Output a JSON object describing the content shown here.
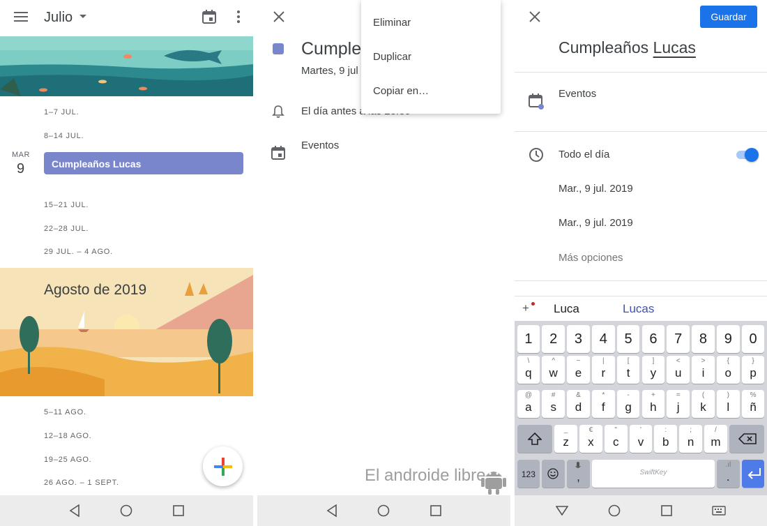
{
  "panel1": {
    "month": "Julio",
    "weeks_july": [
      "1–7 JUL.",
      "8–14 JUL.",
      "15–21 JUL.",
      "22–28 JUL.",
      "29 JUL. – 4 AGO."
    ],
    "day": {
      "dow": "MAR",
      "num": "9"
    },
    "event_label": "Cumpleaños Lucas",
    "august_title": "Agosto de 2019",
    "weeks_august": [
      "5–11 AGO.",
      "12–18 AGO.",
      "19–25 AGO.",
      "26 AGO. – 1 SEPT."
    ]
  },
  "panel2": {
    "event_title": "Cumpleaños Lucas",
    "event_date": "Martes, 9 jul",
    "reminder": "El día antes a las 23:30",
    "calendar": "Eventos",
    "menu": [
      "Eliminar",
      "Duplicar",
      "Copiar en…"
    ],
    "watermark": "El androide libre"
  },
  "panel3": {
    "save_label": "Guardar",
    "title_prefix": "Cumpleaños",
    "title_word": "Lucas",
    "calendar": "Eventos",
    "all_day_label": "Todo el día",
    "all_day_on": true,
    "start_date": "Mar., 9 jul. 2019",
    "end_date": "Mar., 9 jul. 2019",
    "more_options": "Más opciones",
    "suggestions": [
      "Luca",
      "Lucas"
    ],
    "keyboard": {
      "numbers": [
        "1",
        "2",
        "3",
        "4",
        "5",
        "6",
        "7",
        "8",
        "9",
        "0"
      ],
      "row1": [
        "q",
        "w",
        "e",
        "r",
        "t",
        "y",
        "u",
        "i",
        "o",
        "p"
      ],
      "row1_alt": [
        "\\",
        "^",
        "~",
        "|",
        "[",
        "]",
        "<",
        ">",
        "{",
        "}"
      ],
      "row2": [
        "a",
        "s",
        "d",
        "f",
        "g",
        "h",
        "j",
        "k",
        "l",
        "ñ"
      ],
      "row2_alt": [
        "@",
        "#",
        "&",
        "*",
        "-",
        "+",
        "=",
        "(",
        ")",
        "%"
      ],
      "row3": [
        "z",
        "x",
        "c",
        "v",
        "b",
        "n",
        "m"
      ],
      "row3_alt": [
        "_",
        "€",
        "\"",
        "'",
        ":",
        ";",
        "/"
      ],
      "mode_label": "123",
      "mic_sub": ",",
      "space_label": "SwiftKey",
      "period": ".",
      "period_alt": ".ıl"
    }
  }
}
